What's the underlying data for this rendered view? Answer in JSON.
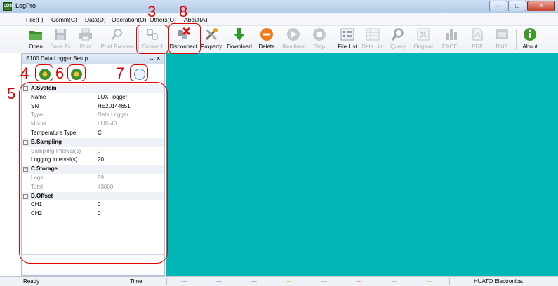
{
  "window": {
    "title": "LogPro -",
    "app_icon": "LOG",
    "min": "—",
    "max": "□",
    "close": "✕"
  },
  "menu": [
    "File(F)",
    "Comm(C)",
    "Data(D)",
    "Operation(O)",
    "Others(O)",
    "About(A)"
  ],
  "toolbar": {
    "open": "Open",
    "save_as": "Save As",
    "print": "Print",
    "print_preview": "Print Preview",
    "connect": "Connect",
    "disconnect": "Disconnect",
    "property": "Property",
    "download": "Download",
    "delete": "Delete",
    "realtime": "Realtime",
    "stop": "Stop",
    "file_list": "File List",
    "data_list": "Data List",
    "query": "Query",
    "original": "Original",
    "excel": "EXCEL",
    "pdf": "PDF",
    "bmp": "BMP",
    "about": "About"
  },
  "panel": {
    "title": "S100 Data Logger Setup",
    "pins": "↔ ✕",
    "categories": [
      {
        "label": "A.System",
        "toggle": "-",
        "rows": [
          {
            "k": "Name",
            "v": "LUX_logger"
          },
          {
            "k": "SN",
            "v": "HE20144651"
          },
          {
            "k": "Type",
            "v": "Data Logger"
          },
          {
            "k": "Model",
            "v": "LUX-40"
          },
          {
            "k": "Temperature Type",
            "v": "C"
          }
        ]
      },
      {
        "label": "B.Sampling",
        "toggle": "-",
        "rows": [
          {
            "k": "Sampling Interval(s)",
            "v": "0"
          },
          {
            "k": "Logging Interval(s)",
            "v": "20"
          }
        ]
      },
      {
        "label": "C.Storage",
        "toggle": "-",
        "rows": [
          {
            "k": "Logs",
            "v": "99"
          },
          {
            "k": "Total",
            "v": "43000"
          }
        ]
      },
      {
        "label": "D.Offset",
        "toggle": "-",
        "rows": [
          {
            "k": "CH1",
            "v": "0"
          },
          {
            "k": "CH2",
            "v": "0"
          }
        ]
      }
    ]
  },
  "status": {
    "ready": "Ready",
    "time": "Time",
    "fields": [
      "---",
      "---",
      "---",
      "---",
      "---",
      "---",
      "---",
      "---"
    ],
    "company": "HUATO Electronics."
  },
  "annotations": {
    "n3": "3",
    "n4": "4",
    "n5": "5",
    "n6": "6",
    "n7": "7",
    "n8": "8"
  },
  "colors": {
    "canvas": "#00b6b6",
    "annotation": "#e10000"
  }
}
